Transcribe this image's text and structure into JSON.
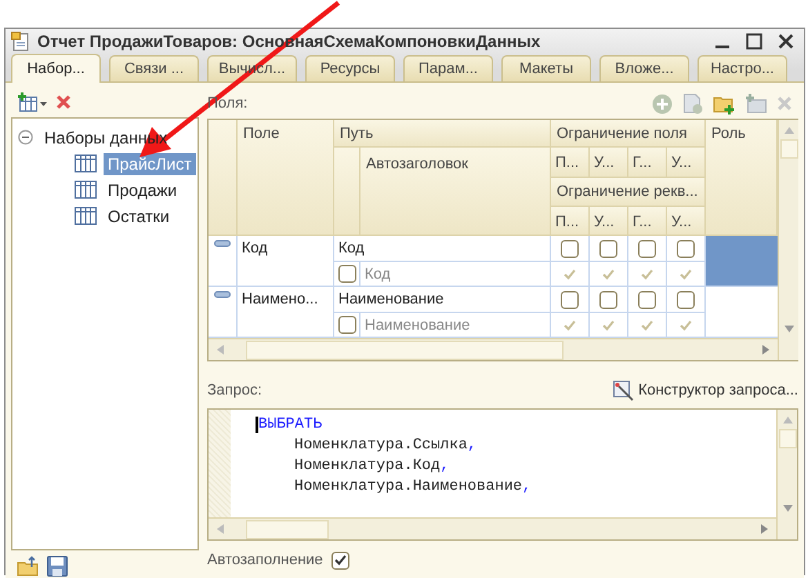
{
  "window": {
    "title": "Отчет ПродажиТоваров: ОсновнаяСхемаКомпоновкиДанных"
  },
  "tabs": [
    {
      "label": "Набор...",
      "selected": true
    },
    {
      "label": "Связи ...",
      "selected": false
    },
    {
      "label": "Вычисл...",
      "selected": false
    },
    {
      "label": "Ресурсы",
      "selected": false
    },
    {
      "label": "Парам...",
      "selected": false
    },
    {
      "label": "Макеты",
      "selected": false
    },
    {
      "label": "Вложе...",
      "selected": false
    },
    {
      "label": "Настро...",
      "selected": false
    }
  ],
  "tree": {
    "label": "Наборы данных",
    "expanded": true,
    "children": [
      {
        "label": "ПрайсЛист",
        "selected": true
      },
      {
        "label": "Продажи",
        "selected": false
      },
      {
        "label": "Остатки",
        "selected": false
      }
    ]
  },
  "fields_label": "Поля:",
  "grid": {
    "header": {
      "field": "Поле",
      "path": "Путь",
      "autotitle": "Автозаголовок",
      "field_restriction": "Ограничение поля",
      "field_restriction_flags": [
        "П...",
        "У...",
        "Г...",
        "У..."
      ],
      "attr_restriction": "Ограничение рекв...",
      "attr_restriction_flags": [
        "П...",
        "У...",
        "Г...",
        "У..."
      ],
      "role": "Роль"
    },
    "rows": [
      {
        "field": "Код",
        "path": "Код",
        "title": "Код",
        "title_auto": false,
        "restrictions": [
          false,
          false,
          false,
          false
        ],
        "attr_restrictions": [
          true,
          true,
          true,
          true
        ],
        "selected": true
      },
      {
        "field": "Наимено...",
        "path": "Наименование",
        "title": "Наименование",
        "title_auto": false,
        "restrictions": [
          false,
          false,
          false,
          false
        ],
        "attr_restrictions": [
          true,
          true,
          true,
          true
        ],
        "selected": false
      }
    ]
  },
  "query": {
    "label": "Запрос:",
    "designer_button": "Конструктор запроса...",
    "lines": [
      {
        "indented": false,
        "tokens": [
          {
            "kind": "keyword",
            "text": "ВЫБРАТЬ"
          }
        ]
      },
      {
        "indented": true,
        "tokens": [
          {
            "kind": "name",
            "text": "Номенклатура.Ссылка"
          },
          {
            "kind": "punct",
            "text": ","
          }
        ]
      },
      {
        "indented": true,
        "tokens": [
          {
            "kind": "name",
            "text": "Номенклатура.Код"
          },
          {
            "kind": "punct",
            "text": ","
          }
        ]
      },
      {
        "indented": true,
        "tokens": [
          {
            "kind": "name",
            "text": "Номенклатура.Наименование"
          },
          {
            "kind": "punct",
            "text": ","
          }
        ]
      }
    ]
  },
  "autofill": {
    "label": "Автозаполнение",
    "checked": true
  }
}
